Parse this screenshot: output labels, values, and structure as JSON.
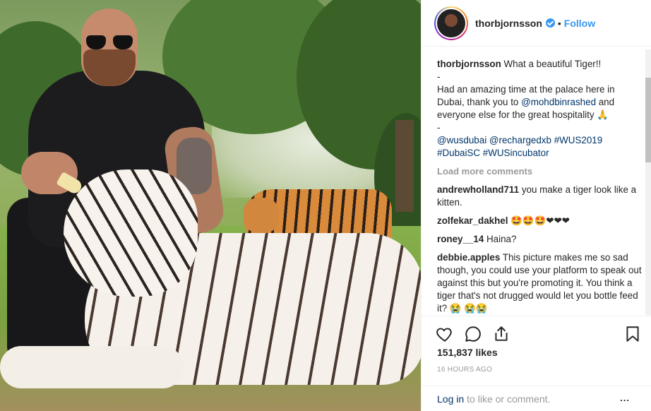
{
  "post": {
    "username": "thorbjornsson",
    "follow_label": "Follow",
    "dot": "•",
    "photo_alt": "Man bottle-feeding a white tiger with an orange tiger in the background"
  },
  "caption": {
    "user": "thorbjornsson",
    "line1": "What a beautiful Tiger!!",
    "dash1": "-",
    "body_prefix": "Had an amazing time at the palace here in Dubai, thank you to ",
    "mention1": "@mohdbinrashed",
    "body_suffix": " and everyone else for the great hospitality 🙏",
    "dash2": "-",
    "tags": [
      "@wusdubai",
      "@rechargedxb",
      "#WUS2019",
      "#DubaiSC",
      "#WUSincubator"
    ]
  },
  "load_more": "Load more comments",
  "comments": [
    {
      "user": "andrewholland711",
      "text": "you make a tiger look like a kitten."
    },
    {
      "user": "zolfekar_dakhel",
      "text": "🤩🤩🤩❤❤❤"
    },
    {
      "user": "roney__14",
      "text": "Haina?"
    },
    {
      "user": "debbie.apples",
      "text": "This picture makes me so sad though, you could use your platform to speak out against this but you're promoting it. You think a tiger that's not drugged would let you bottle feed it? 😭 😭😭"
    }
  ],
  "icons": {
    "like": "heart-icon",
    "comment": "comment-icon",
    "share": "share-icon",
    "save": "bookmark-icon",
    "verified": "verified-badge-icon"
  },
  "likes": "151,837 likes",
  "timestamp": "16 HOURS AGO",
  "footer": {
    "login_label": "Log in",
    "suffix": "to like or comment.",
    "more": "..."
  },
  "colors": {
    "link": "#3897f0",
    "tag": "#003569",
    "muted": "#999999",
    "text": "#262626"
  }
}
